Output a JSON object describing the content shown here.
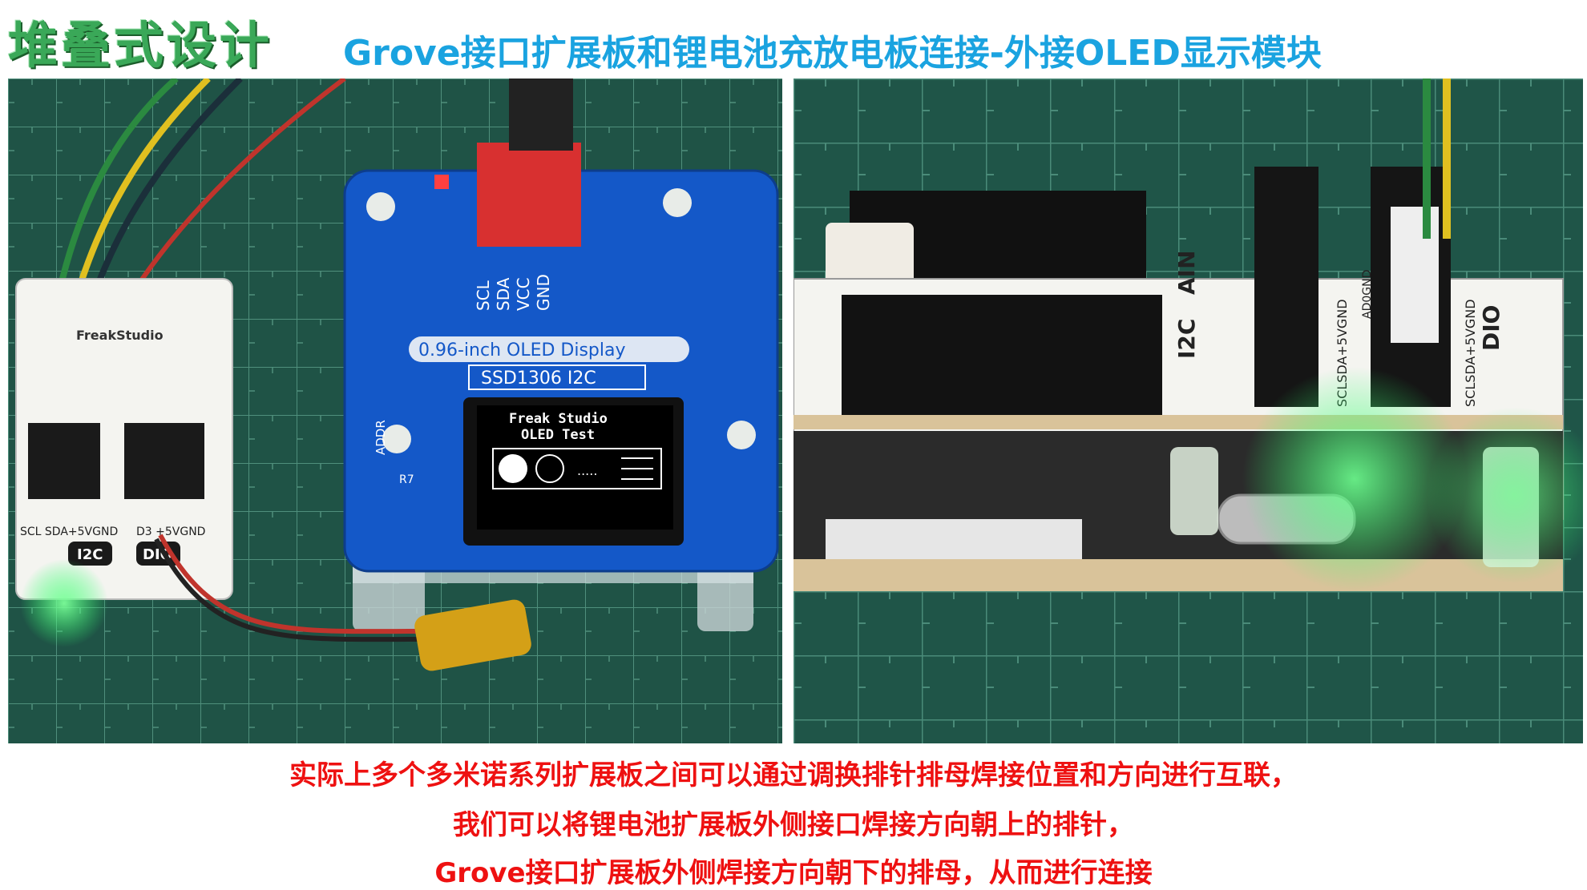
{
  "header": {
    "title": "堆叠式设计",
    "subtitle": "Grove接口扩展板和锂电池充放电板连接-外接OLED显示模块"
  },
  "photos": {
    "left": {
      "oled_screen_line1": "Freak Studio",
      "oled_screen_line2": "OLED Test",
      "oled_board_title": "0.96-inch OLED Display",
      "oled_board_model": "SSD1306  I2C",
      "pin_labels": [
        "SCL",
        "SDA",
        "VCC",
        "GND"
      ],
      "addr_label": "ADDR",
      "brand_label": "FreakStudio",
      "port_i2c": "I2C",
      "port_dio": "DIO",
      "port_row_left": "SCL SDA+5VGND",
      "port_row_right": "D3    +5VGND",
      "r7_label": "R7"
    },
    "right": {
      "label_i2c": "I2C",
      "label_ain": "AIN",
      "label_dio": "DIO",
      "label_pins1": "SCLSDA+5VGND",
      "label_pins2": "SCLSDA+5VGND",
      "label_pins3": "AD0GND"
    }
  },
  "captions": [
    "实际上多个多米诺系列扩展板之间可以通过调换排针排母焊接位置和方向进行互联，",
    "我们可以将锂电池扩展板外侧接口焊接方向朝上的排针，",
    "Grove接口扩展板外侧焊接方向朝下的排母，从而进行连接"
  ],
  "colors": {
    "title_green": "#3aa858",
    "subtitle_blue": "#1aa3e0",
    "caption_red": "#ee1111",
    "mat_green": "#1d4e43"
  }
}
